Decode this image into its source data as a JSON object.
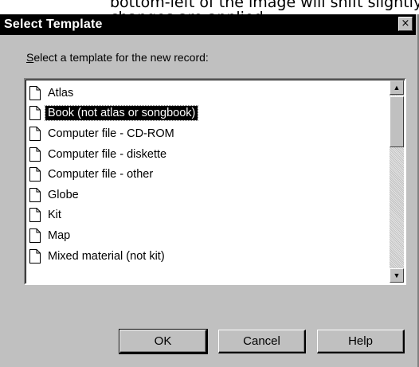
{
  "caption": "bottom-left of the image will shift slightly when changes are applied",
  "dialog": {
    "title": "Select Template",
    "close_label": "×",
    "prompt_prefix": "S",
    "prompt_rest": "elect a template for the new record:"
  },
  "templates": {
    "items": [
      {
        "label": "Atlas",
        "selected": false
      },
      {
        "label": "Book (not atlas or songbook)",
        "selected": true
      },
      {
        "label": "Computer file - CD-ROM",
        "selected": false
      },
      {
        "label": "Computer file - diskette",
        "selected": false
      },
      {
        "label": "Computer file - other",
        "selected": false
      },
      {
        "label": "Globe",
        "selected": false
      },
      {
        "label": "Kit",
        "selected": false
      },
      {
        "label": "Map",
        "selected": false
      },
      {
        "label": "Mixed material (not kit)",
        "selected": false
      }
    ]
  },
  "buttons": {
    "ok": "OK",
    "cancel": "Cancel",
    "help": "Help"
  },
  "colors": {
    "dialog_bg": "#c0c0c0",
    "titlebar_bg": "#000000",
    "selection_bg": "#000000"
  },
  "icons": {
    "row_icon": "document-icon",
    "close": "close-icon",
    "scroll_up": "arrow-up-icon",
    "scroll_down": "arrow-down-icon"
  }
}
